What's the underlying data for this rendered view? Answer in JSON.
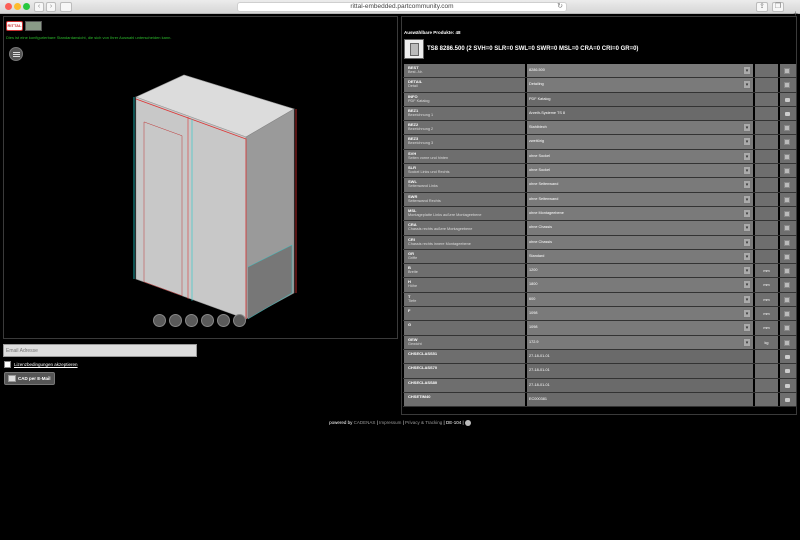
{
  "browser": {
    "url": "rittal-embedded.partcommunity.com",
    "back": "‹",
    "forward": "›"
  },
  "viewer": {
    "hint": "Dies ist eine konfigurierbare Standardansicht, die sich von Ihrer Auswahl unterscheiden kann.",
    "logo_text": "RITTAL",
    "email_placeholder": "Email Adresse",
    "agree_label": "Lizenzbedingungen akzeptieren",
    "cad_button": "CAD per E-Mail"
  },
  "product": {
    "count_label": "Auswählbare Produkte: 48",
    "title": "TS8 8286.500 (2 SVH=0 SLR=0 SWL=0 SWR=0 MSL=0 CRA=0 CRI=0 GR=0)"
  },
  "table": [
    {
      "code": "BEST",
      "desc": "Best.-Nr.",
      "value": "8286.500",
      "select": true,
      "unit": "",
      "act": "edit"
    },
    {
      "code": "DETAIL",
      "desc": "Detail",
      "value": "Detailing",
      "select": true,
      "unit": "",
      "act": "edit"
    },
    {
      "code": "INFO",
      "desc": "PDF Katalog",
      "value": "PDF Katalog",
      "select": false,
      "unit": "",
      "act": "lock"
    },
    {
      "code": "BEZ1",
      "desc": "Bezeichnung 1",
      "value": "Anreih-Systeme TS 8",
      "select": false,
      "unit": "",
      "act": "lock"
    },
    {
      "code": "BEZ2",
      "desc": "Bezeichnung 2",
      "value": "Stahlblech",
      "select": true,
      "unit": "",
      "act": "edit"
    },
    {
      "code": "BEZ3",
      "desc": "Bezeichnung 3",
      "value": "zweitürig",
      "select": true,
      "unit": "",
      "act": "edit"
    },
    {
      "code": "SVH",
      "desc": "Seiten vorne und hinten",
      "value": "ohne Sockel",
      "select": true,
      "unit": "",
      "act": "edit"
    },
    {
      "code": "SLR",
      "desc": "Sockel Links und Rechts",
      "value": "ohne Sockel",
      "select": true,
      "unit": "",
      "act": "edit"
    },
    {
      "code": "SWL",
      "desc": "Seitenwand Links",
      "value": "ohne Seitenwand",
      "select": true,
      "unit": "",
      "act": "edit"
    },
    {
      "code": "SWR",
      "desc": "Seitenwand Rechts",
      "value": "ohne Seitenwand",
      "select": true,
      "unit": "",
      "act": "edit"
    },
    {
      "code": "MSL",
      "desc": "Montageplatte Links außere Montageebene",
      "value": "ohne Montageebene",
      "select": true,
      "unit": "",
      "act": "edit"
    },
    {
      "code": "CRA",
      "desc": "Chassis rechts außere Montageebene",
      "value": "ohne Chassis",
      "select": true,
      "unit": "",
      "act": "edit"
    },
    {
      "code": "CRI",
      "desc": "Chassis rechts innere Montageebene",
      "value": "ohne Chassis",
      "select": true,
      "unit": "",
      "act": "edit"
    },
    {
      "code": "GR",
      "desc": "Griffe",
      "value": "Standard",
      "select": true,
      "unit": "",
      "act": "edit"
    },
    {
      "code": "B",
      "desc": "Breite",
      "value": "1200",
      "select": true,
      "unit": "mm",
      "act": "edit"
    },
    {
      "code": "H",
      "desc": "Höhe",
      "value": "1800",
      "select": true,
      "unit": "mm",
      "act": "edit"
    },
    {
      "code": "T",
      "desc": "Tiefe",
      "value": "600",
      "select": true,
      "unit": "mm",
      "act": "edit"
    },
    {
      "code": "F",
      "desc": "",
      "value": "1098",
      "select": true,
      "unit": "mm",
      "act": "edit"
    },
    {
      "code": "G",
      "desc": "",
      "value": "1098",
      "select": true,
      "unit": "mm",
      "act": "edit"
    },
    {
      "code": "GEW",
      "desc": "Gewicht",
      "value": "172.9",
      "select": true,
      "unit": "kg",
      "act": "edit"
    },
    {
      "code": "CHSECLASS51",
      "desc": "",
      "value": "27-18-01-01",
      "select": false,
      "unit": "",
      "act": "lock"
    },
    {
      "code": "CHSECLASS70",
      "desc": "",
      "value": "27-18-01-01",
      "select": false,
      "unit": "",
      "act": "lock"
    },
    {
      "code": "CHSECLASS80",
      "desc": "",
      "value": "27-18-01-01",
      "select": false,
      "unit": "",
      "act": "lock"
    },
    {
      "code": "CHSETIM40",
      "desc": "",
      "value": "EC000381",
      "select": false,
      "unit": "",
      "act": "lock"
    }
  ],
  "footer": {
    "powered": "powered by",
    "brand": "CADENAS",
    "impressum": "Impressum",
    "privacy": "Privacy & Tracking",
    "lang": "DE-104"
  },
  "colors": {
    "hint": "#2dbd2d",
    "cell": "#6e6e6e",
    "background": "#000000"
  }
}
